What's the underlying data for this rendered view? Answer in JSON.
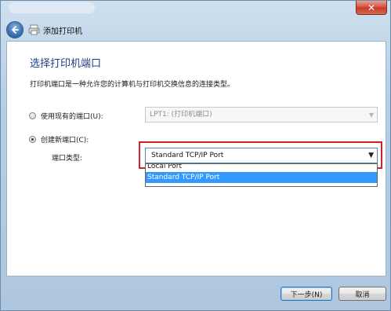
{
  "window": {
    "title": "添加打印机",
    "close_glyph": "✕"
  },
  "page": {
    "title": "选择打印机端口",
    "description": "打印机端口是一种允许您的计算机与打印机交换信息的连接类型。"
  },
  "existing_port": {
    "label": "使用现有的端口(U):",
    "selected": false,
    "value": "LPT1: (打印机端口)"
  },
  "new_port": {
    "label": "创建新端口(C):",
    "selected": true,
    "type_label": "端口类型:",
    "value": "Standard TCP/IP Port",
    "options": [
      "Local Port",
      "Standard TCP/IP Port"
    ],
    "highlighted_option": "Standard TCP/IP Port"
  },
  "footer": {
    "next": "下一步(N)",
    "cancel": "取消"
  },
  "icons": {
    "back": "back-arrow-icon",
    "printer": "printer-icon",
    "close": "close-icon",
    "dropdown": "chevron-down-icon"
  },
  "colors": {
    "title_blue": "#1f3c87",
    "selection_blue": "#3399ff",
    "highlight_red": "#d3202d"
  }
}
